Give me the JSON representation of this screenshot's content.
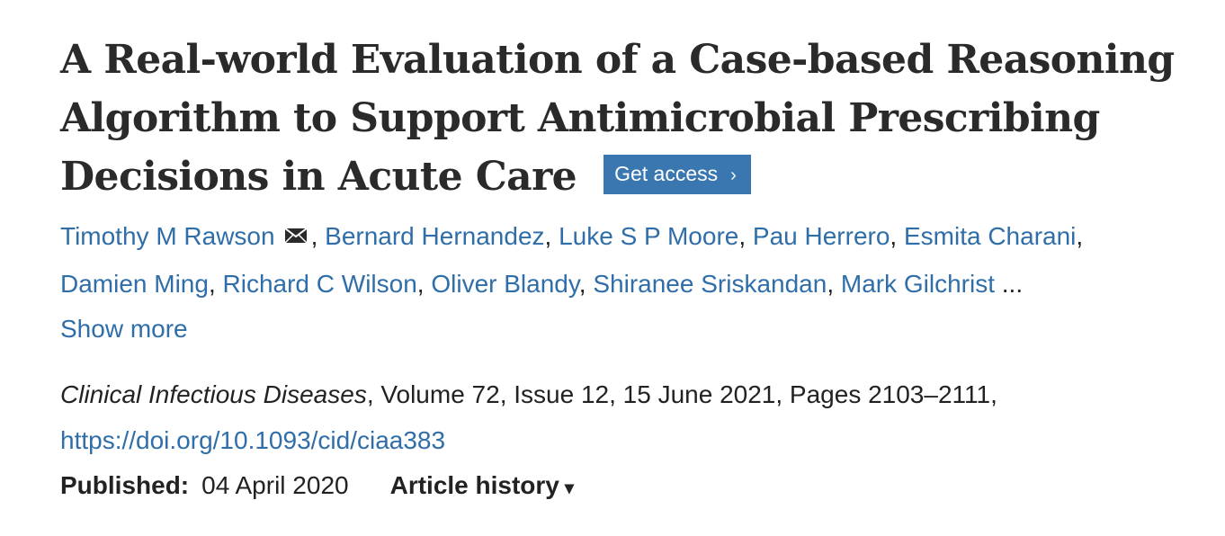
{
  "article": {
    "title_lines": [
      "A Real-world Evaluation of a Case-based Reasoning",
      "Algorithm to Support Antimicrobial Prescribing",
      "Decisions in Acute Care"
    ],
    "get_access_label": "Get access",
    "get_access_chevron": "›",
    "authors": [
      "Timothy M Rawson",
      "Bernard Hernandez",
      "Luke S P Moore",
      "Pau Herrero",
      "Esmita Charani",
      "Damien Ming",
      "Richard C Wilson",
      "Oliver Blandy",
      "Shiranee Sriskandan",
      "Mark Gilchrist"
    ],
    "author_separator": ", ",
    "authors_ellipsis": " ...",
    "show_more_label": "Show more",
    "journal": "Clinical Infectious Diseases",
    "citation_rest": ", Volume 72, Issue 12, 15 June 2021, Pages 2103–2111,",
    "doi": "https://doi.org/10.1093/cid/ciaa383",
    "published_label": "Published:",
    "published_date": "04 April 2020",
    "article_history_label": "Article history",
    "article_history_caret": "▾"
  },
  "colors": {
    "link": "#2f6ea8",
    "button_bg": "#3a77b0",
    "text": "#222222"
  },
  "icons": {
    "corresponding_author": "envelope-icon"
  }
}
